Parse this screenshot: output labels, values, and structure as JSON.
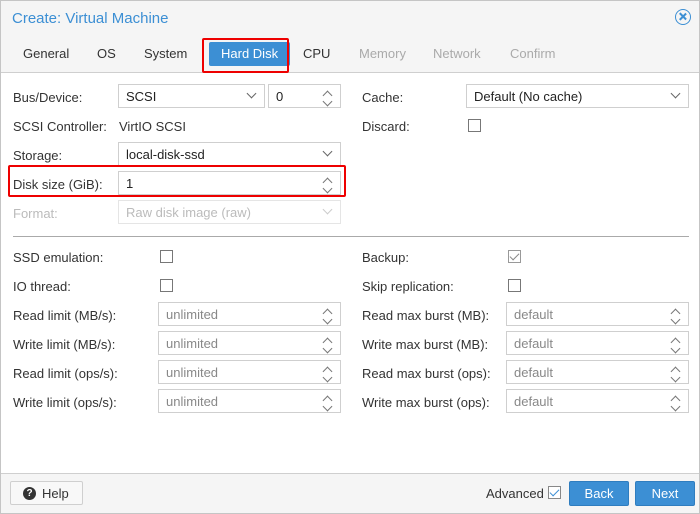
{
  "window": {
    "title": "Create: Virtual Machine"
  },
  "tabs": [
    {
      "label": "General"
    },
    {
      "label": "OS"
    },
    {
      "label": "System"
    },
    {
      "label": "Hard Disk"
    },
    {
      "label": "CPU"
    },
    {
      "label": "Memory"
    },
    {
      "label": "Network"
    },
    {
      "label": "Confirm"
    }
  ],
  "active_tab": "Hard Disk",
  "form": {
    "bus_device": {
      "label": "Bus/Device:",
      "bus": "SCSI",
      "device": "0"
    },
    "scsi_controller": {
      "label": "SCSI Controller:",
      "value": "VirtIO SCSI"
    },
    "storage": {
      "label": "Storage:",
      "value": "local-disk-ssd"
    },
    "disk_size": {
      "label": "Disk size (GiB):",
      "value": "1"
    },
    "format": {
      "label": "Format:",
      "value": "Raw disk image (raw)"
    },
    "cache": {
      "label": "Cache:",
      "value": "Default (No cache)"
    },
    "discard": {
      "label": "Discard:",
      "checked": false
    }
  },
  "advanced": {
    "ssd_emulation": {
      "label": "SSD emulation:",
      "checked": false
    },
    "io_thread": {
      "label": "IO thread:",
      "checked": false
    },
    "read_limit_mb": {
      "label": "Read limit (MB/s):",
      "placeholder": "unlimited"
    },
    "write_limit_mb": {
      "label": "Write limit (MB/s):",
      "placeholder": "unlimited"
    },
    "read_limit_ops": {
      "label": "Read limit (ops/s):",
      "placeholder": "unlimited"
    },
    "write_limit_ops": {
      "label": "Write limit (ops/s):",
      "placeholder": "unlimited"
    },
    "backup": {
      "label": "Backup:",
      "checked": true
    },
    "skip_replication": {
      "label": "Skip replication:",
      "checked": false
    },
    "read_burst_mb": {
      "label": "Read max burst (MB):",
      "placeholder": "default"
    },
    "write_burst_mb": {
      "label": "Write max burst (MB):",
      "placeholder": "default"
    },
    "read_burst_ops": {
      "label": "Read max burst (ops):",
      "placeholder": "default"
    },
    "write_burst_ops": {
      "label": "Write max burst (ops):",
      "placeholder": "default"
    }
  },
  "footer": {
    "help_label": "Help",
    "advanced_label": "Advanced",
    "advanced_checked": true,
    "back_label": "Back",
    "next_label": "Next"
  },
  "colors": {
    "accent": "#3c8fd4",
    "highlight": "#e00000"
  },
  "icons": {
    "close": "close-circle-icon",
    "help": "help-icon",
    "chevron": "chevron-down-icon",
    "spinner": "spinner-icon"
  }
}
